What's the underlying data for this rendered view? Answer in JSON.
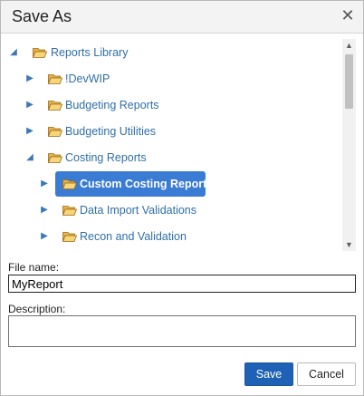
{
  "dialog": {
    "title": "Save As",
    "close_icon": "close-icon"
  },
  "tree": {
    "nodes": [
      {
        "label": "Reports Library",
        "expanded": true,
        "icon": "folder-open-icon",
        "level": 0
      },
      {
        "label": "!DevWIP",
        "expanded": false,
        "icon": "folder-icon",
        "level": 1
      },
      {
        "label": "Budgeting Reports",
        "expanded": false,
        "icon": "folder-icon",
        "level": 1
      },
      {
        "label": "Budgeting Utilities",
        "expanded": false,
        "icon": "folder-icon",
        "level": 1
      },
      {
        "label": "Costing Reports",
        "expanded": true,
        "icon": "folder-open-icon",
        "level": 1
      },
      {
        "label": "Custom Costing Reports",
        "expanded": false,
        "icon": "folder-open-icon",
        "level": 2,
        "selected": true
      },
      {
        "label": "Data Import Validations",
        "expanded": false,
        "icon": "folder-icon",
        "level": 2
      },
      {
        "label": "Recon and Validation",
        "expanded": false,
        "icon": "folder-icon",
        "level": 2
      }
    ]
  },
  "form": {
    "file_name_label": "File name:",
    "file_name_value": "MyReport",
    "description_label": "Description:",
    "description_value": ""
  },
  "buttons": {
    "save_label": "Save",
    "cancel_label": "Cancel"
  },
  "colors": {
    "link_blue": "#2f6fa8",
    "selected_bg": "#3a7bd3",
    "save_bg": "#1f62b5"
  }
}
